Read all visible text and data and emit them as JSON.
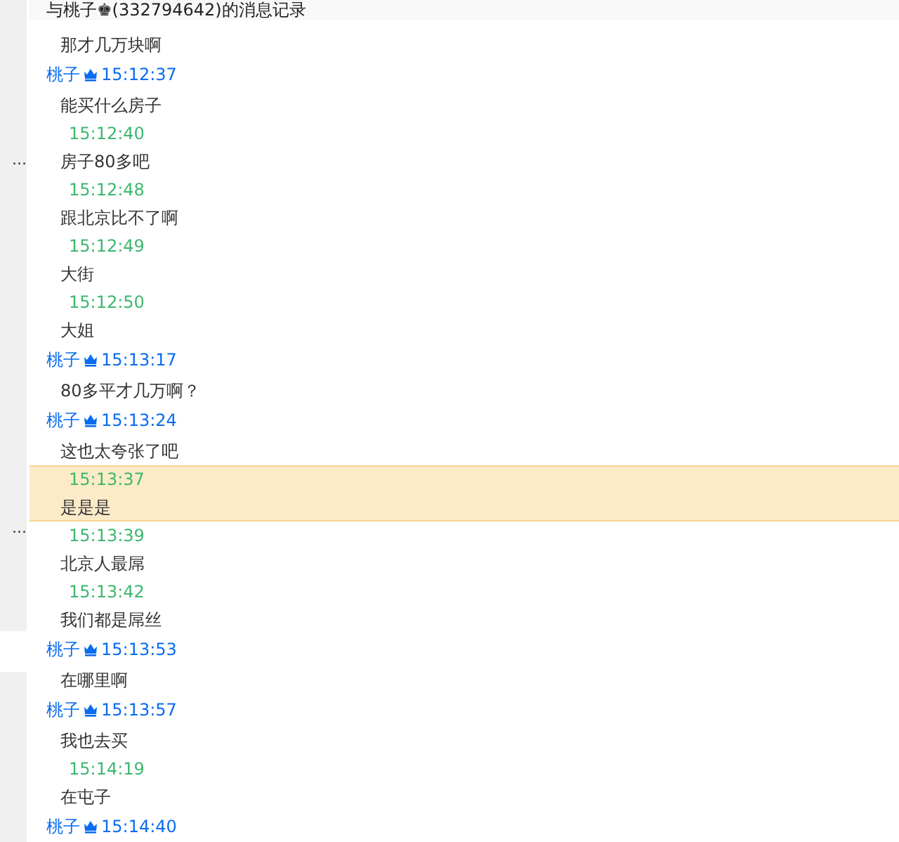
{
  "window": {
    "title": "与桃子♚(332794642)的消息记录"
  },
  "sidebar": {
    "items": [
      {
        "label": "..."
      },
      {
        "label": "..."
      }
    ]
  },
  "entries": [
    {
      "kind": "continuation",
      "text": "那才几万块啊",
      "selected": false
    },
    {
      "kind": "peer",
      "sender": "桃子",
      "time": "15:12:37",
      "text": "能买什么房子",
      "selected": false
    },
    {
      "kind": "self",
      "time": "15:12:40",
      "text": "房子80多吧",
      "selected": false
    },
    {
      "kind": "self",
      "time": "15:12:48",
      "text": "跟北京比不了啊",
      "selected": false
    },
    {
      "kind": "self",
      "time": "15:12:49",
      "text": "大街",
      "selected": false
    },
    {
      "kind": "self",
      "time": "15:12:50",
      "text": "大姐",
      "selected": false
    },
    {
      "kind": "peer",
      "sender": "桃子",
      "time": "15:13:17",
      "text": "80多平才几万啊？",
      "selected": false
    },
    {
      "kind": "peer",
      "sender": "桃子",
      "time": "15:13:24",
      "text": "这也太夸张了吧",
      "selected": false
    },
    {
      "kind": "self",
      "time": "15:13:37",
      "text": "是是是",
      "selected": true
    },
    {
      "kind": "self",
      "time": "15:13:39",
      "text": "北京人最屌",
      "selected": false
    },
    {
      "kind": "self",
      "time": "15:13:42",
      "text": "我们都是屌丝",
      "selected": false
    },
    {
      "kind": "peer",
      "sender": "桃子",
      "time": "15:13:53",
      "text": "在哪里啊",
      "selected": false
    },
    {
      "kind": "peer",
      "sender": "桃子",
      "time": "15:13:57",
      "text": "我也去买",
      "selected": false
    },
    {
      "kind": "self",
      "time": "15:14:19",
      "text": "在屯子",
      "selected": false
    },
    {
      "kind": "peer",
      "sender": "桃子",
      "time": "15:14:40",
      "selected": false
    }
  ]
}
